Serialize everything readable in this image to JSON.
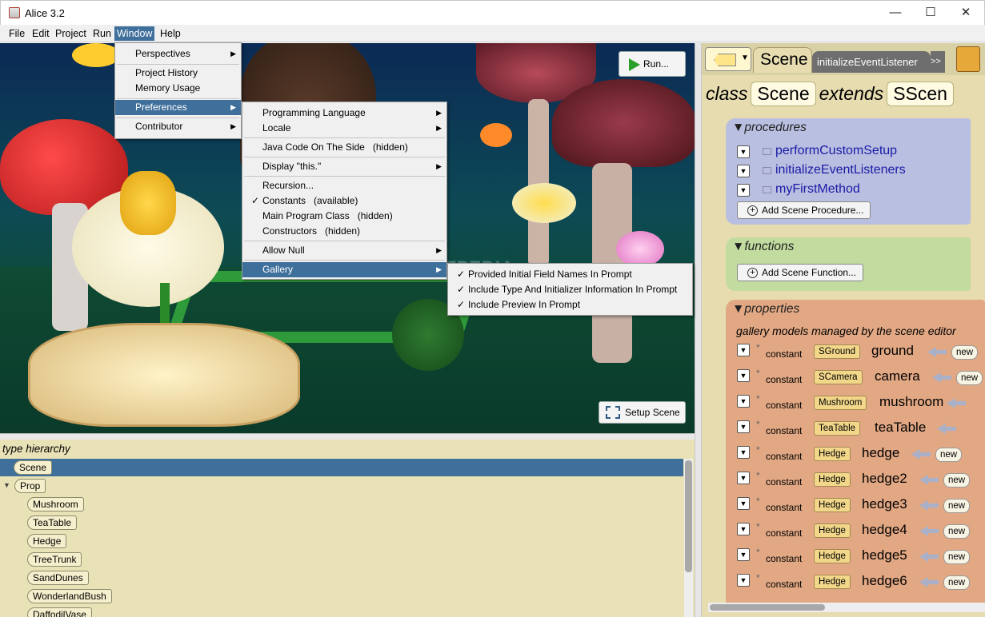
{
  "window": {
    "title": "Alice 3.2",
    "minimize_glyph": "—",
    "maximize_glyph": "☐",
    "close_glyph": "✕"
  },
  "menubar": {
    "items": [
      "File",
      "Edit",
      "Project",
      "Run",
      "Window",
      "Help"
    ],
    "active": "Window"
  },
  "window_menu": {
    "items": [
      "Perspectives",
      "Project History",
      "Memory Usage",
      "Preferences",
      "Contributor"
    ],
    "selected": "Preferences"
  },
  "preferences_menu": {
    "items": [
      "Programming Language",
      "Locale",
      "Java Code On The Side   (hidden)",
      "Display \"this.\"",
      "Recursion...",
      "Constants   (available)",
      "Main Program Class   (hidden)",
      "Constructors   (hidden)",
      "Allow Null",
      "Gallery"
    ],
    "checked": "Constants   (available)",
    "selected": "Gallery"
  },
  "gallery_menu": {
    "items": [
      "Provided Initial Field Names In Prompt",
      "Include Type And Initializer Information In Prompt",
      "Include Preview In Prompt"
    ],
    "all_checked": true
  },
  "viewport": {
    "run_label": "Run...",
    "setup_label": "Setup Scene",
    "watermark": "SOFTPEDIA"
  },
  "hierarchy": {
    "title": "type hierarchy",
    "root": "Scene",
    "prop": "Prop",
    "children": [
      "Mushroom",
      "TeaTable",
      "Hedge",
      "TreeTrunk",
      "SandDunes",
      "WonderlandBush",
      "DaffodilVase"
    ]
  },
  "code": {
    "tab_scene": "Scene",
    "tab_event": "initializeEventListener",
    "tab_more": ">>",
    "class_kw": "class",
    "class_name": "Scene",
    "extends_kw": "extends",
    "super_name": "SScen",
    "procedures_title": "procedures",
    "procedures": [
      "performCustomSetup",
      "initializeEventListeners",
      "myFirstMethod"
    ],
    "add_procedure": "Add Scene Procedure...",
    "functions_title": "functions",
    "add_function": "Add Scene Function...",
    "properties_title": "properties",
    "properties_caption": "gallery models managed by the scene editor",
    "constant_kw": "constant",
    "new_kw": "new",
    "properties": [
      {
        "type": "SGround",
        "name": "ground"
      },
      {
        "type": "SCamera",
        "name": "camera"
      },
      {
        "type": "Mushroom",
        "name": "mushroom"
      },
      {
        "type": "TeaTable",
        "name": "teaTable"
      },
      {
        "type": "Hedge",
        "name": "hedge"
      },
      {
        "type": "Hedge",
        "name": "hedge2"
      },
      {
        "type": "Hedge",
        "name": "hedge3"
      },
      {
        "type": "Hedge",
        "name": "hedge4"
      },
      {
        "type": "Hedge",
        "name": "hedge5"
      },
      {
        "type": "Hedge",
        "name": "hedge6"
      }
    ]
  },
  "colors": {
    "accent_selection": "#3f6f9b",
    "procedures_bg": "#b9bfe0",
    "functions_bg": "#c2dca0",
    "properties_bg": "#e2a884"
  }
}
